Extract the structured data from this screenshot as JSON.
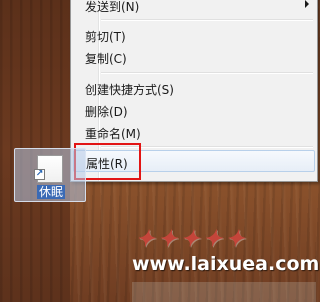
{
  "context_menu": {
    "items": [
      {
        "label": "发送到(N)",
        "has_submenu": true
      },
      {
        "label": "剪切(T)"
      },
      {
        "label": "复制(C)"
      },
      {
        "label": "创建快捷方式(S)"
      },
      {
        "label": "删除(D)"
      },
      {
        "label": "重命名(M)"
      },
      {
        "label": "属性(R)",
        "highlighted": true
      }
    ]
  },
  "desktop": {
    "shortcut": {
      "label": "休眠",
      "icon": "shortcut-file-icon",
      "badge_icon": "shortcut-arrow-icon"
    }
  },
  "watermark": {
    "text": "www.laixuea.com"
  },
  "colors": {
    "highlight_border": "#e21414",
    "selection_label_bg": "#3a6ab5",
    "menu_bg": "#f1f1f1"
  }
}
